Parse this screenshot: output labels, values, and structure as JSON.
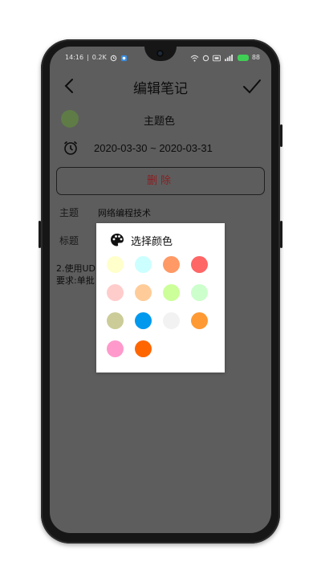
{
  "status_bar": {
    "time": "14:16",
    "network_speed": "0.2K",
    "battery_level": "88"
  },
  "header": {
    "title": "编辑笔记"
  },
  "theme": {
    "label": "主题色",
    "current_color": "#5f7c47"
  },
  "date": {
    "range": "2020-03-30 ~ 2020-03-31"
  },
  "actions": {
    "delete_label": "删除"
  },
  "fields": {
    "subject_label": "主题",
    "subject_value": "网络编程技术",
    "title_label": "标题"
  },
  "content": {
    "line1": "2.使用UD",
    "line2": "要求:单批"
  },
  "color_dialog": {
    "title": "选择颜色",
    "colors": [
      "#ffffcc",
      "#ccffff",
      "#ff9966",
      "#ff6666",
      "#ffcccc",
      "#ffcc99",
      "#ccff99",
      "#ccffcc",
      "#cccc99",
      "#0099ee",
      "#f2f2f2",
      "#ff9933",
      "#ff99cc",
      "#ff6600"
    ]
  }
}
